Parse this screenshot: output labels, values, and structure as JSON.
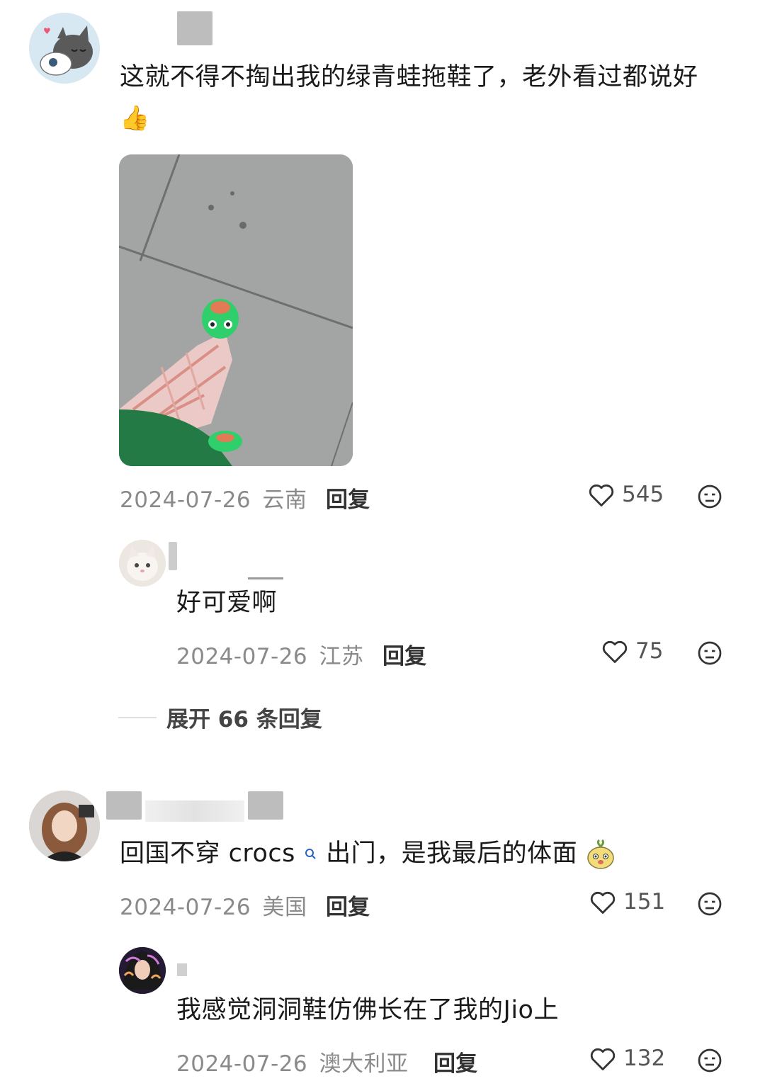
{
  "comments": [
    {
      "text": "这就不得不掏出我的绿青蛙拖鞋了，老外看过都说好",
      "date": "2024-07-26",
      "location": "云南",
      "reply_label": "回复",
      "likes": "545",
      "icons": {
        "like": "heart-outline-icon",
        "dislike": "neutral-face-icon",
        "emoji": "thumbs-up-emoji"
      },
      "has_image": true
    },
    {
      "text": "好可爱啊",
      "date": "2024-07-26",
      "location": "江苏",
      "reply_label": "回复",
      "likes": "75"
    },
    {
      "text_prefix": "回国不穿 crocs",
      "text_suffix": " 出门，是我最后的体面",
      "date": "2024-07-26",
      "location": "美国",
      "reply_label": "回复",
      "likes": "151"
    },
    {
      "text": "我感觉洞洞鞋仿佛长在了我的Jio上",
      "date": "2024-07-26",
      "location": "澳大利亚",
      "reply_label": "回复",
      "likes": "132"
    }
  ],
  "expand": {
    "label": "展开 66 条回复"
  },
  "colors": {
    "frog_green": "#2fcf6b",
    "text": "#1a1a1a",
    "meta": "#8a8a8a"
  }
}
